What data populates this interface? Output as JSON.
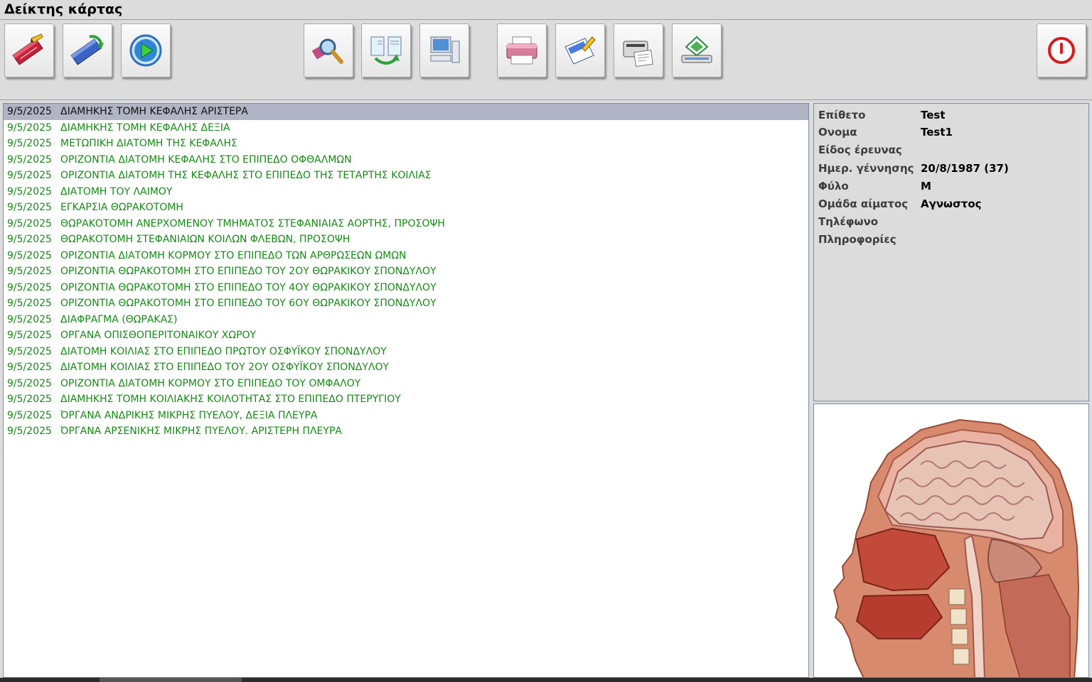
{
  "window": {
    "title": "Δείκτης κάρτας"
  },
  "toolbar": {
    "buttons": [
      {
        "icon": "edit-card-icon"
      },
      {
        "icon": "refresh-card-icon"
      },
      {
        "icon": "play-icon"
      },
      {
        "icon": "search-icon"
      },
      {
        "icon": "exchange-documents-icon"
      },
      {
        "icon": "computer-icon"
      },
      {
        "icon": "printer-icon"
      },
      {
        "icon": "edit-document-icon"
      },
      {
        "icon": "fax-printer-icon"
      },
      {
        "icon": "scanner-icon"
      },
      {
        "icon": "power-icon"
      }
    ]
  },
  "records": [
    {
      "date": "9/5/2025",
      "title": "ΔΙΑΜΗΚΗΣ ΤΟΜΗ ΚΕΦΑΛΗΣ ΑΡΙΣΤΕΡΑ",
      "selected": true
    },
    {
      "date": "9/5/2025",
      "title": "ΔΙΑΜΗΚΗΣ ΤΟΜΗ ΚΕΦΑΛΗΣ ΔΕΞΙΑ"
    },
    {
      "date": "9/5/2025",
      "title": "ΜΕΤΩΠΙΚΗ ΔΙΑΤΟΜΗ ΤΗΣ ΚΕΦΑΛΗΣ"
    },
    {
      "date": "9/5/2025",
      "title": "ΟΡΙΖΟΝΤΙΑ ΔΙΑΤΟΜΗ ΚΕΦΑΛΗΣ ΣΤΟ ΕΠΙΠΕΔΟ ΟΦΘΑΛΜΩΝ"
    },
    {
      "date": "9/5/2025",
      "title": "ΟΡΙΖΟΝΤΙΑ ΔΙΑΤΟΜΗ ΤΗΣ ΚΕΦΑΛΗΣ ΣΤΟ ΕΠΙΠΕΔΟ ΤΗΣ ΤΕΤΑΡΤΗΣ ΚΟΙΛΙΑΣ"
    },
    {
      "date": "9/5/2025",
      "title": "ΔΙΑΤΟΜΗ ΤΟΥ ΛΑΙΜΟΥ"
    },
    {
      "date": "9/5/2025",
      "title": "ΕΓΚΑΡΣΙΑ ΘΩΡΑΚΟΤΟΜΗ"
    },
    {
      "date": "9/5/2025",
      "title": "ΘΩΡΑΚΟΤΟΜΗ ΑΝΕΡΧΟΜΕΝΟΥ ΤΜΗΜΑΤΟΣ ΣΤΕΦΑΝΙΑΙΑΣ  ΑΟΡΤΗΣ, ΠΡΟΣΟΨΗ"
    },
    {
      "date": "9/5/2025",
      "title": "ΘΩΡΑΚΟΤΟΜΗ ΣΤΕΦΑΝΙΑΙΩΝ ΚΟΙΛΩΝ ΦΛΕΒΩΝ, ΠΡΟΣΟΨΗ"
    },
    {
      "date": "9/5/2025",
      "title": "ΟΡΙΖΟΝΤΙΑ ΔΙΑΤΟΜΗ ΚΟΡΜΟΥ ΣΤΟ ΕΠΙΠΕΔΟ ΤΩΝ ΑΡΘΡΩΣΕΩΝ ΩΜΩΝ"
    },
    {
      "date": "9/5/2025",
      "title": "ΟΡΙΖΟΝΤΙΑ ΘΩΡΑΚΟΤΟΜΗ ΣΤΟ ΕΠΙΠΕΔΟ ΤΟΥ 2ΟΥ ΘΩΡΑΚΙΚΟΥ ΣΠΟΝΔΥΛΟΥ"
    },
    {
      "date": "9/5/2025",
      "title": "ΟΡΙΖΟΝΤΙΑ ΘΩΡΑΚΟΤΟΜΗ ΣΤΟ ΕΠΙΠΕΔΟ ΤΟΥ 4ΟΥ ΘΩΡΑΚΙΚΟΥ ΣΠΟΝΔΥΛΟΥ"
    },
    {
      "date": "9/5/2025",
      "title": "ΟΡΙΖΟΝΤΙΑ ΘΩΡΑΚΟΤΟΜΗ ΣΤΟ ΕΠΙΠΕΔΟ ΤΟΥ 6ΟΥ ΘΩΡΑΚΙΚΟΥ ΣΠΟΝΔΥΛΟΥ"
    },
    {
      "date": "9/5/2025",
      "title": "ΔΙΑΦΡΑΓΜΑ (ΘΩΡΑΚΑΣ)"
    },
    {
      "date": "9/5/2025",
      "title": "ΟΡΓΑΝΑ ΟΠΙΣΘΟΠΕΡΙΤΟΝΑΙΚΟΥ ΧΩΡΟΥ"
    },
    {
      "date": "9/5/2025",
      "title": "ΔΙΑΤΟΜΗ ΚΟΙΛΙΑΣ ΣΤΟ ΕΠΙΠΕΔΟ ΠΡΩΤΟΥ ΟΣΦΥΪΚΟΥ ΣΠΟΝΔΥΛΟΥ"
    },
    {
      "date": "9/5/2025",
      "title": "ΔΙΑΤΟΜΗ  ΚΟΙΛΙΑΣ ΣΤΟ ΕΠΙΠΕΔΟ ΤΟΥ 2ΟΥ ΟΣΦΥΪΚΟΥ ΣΠΟΝΔΥΛΟΥ"
    },
    {
      "date": "9/5/2025",
      "title": "ΟΡΙΖΟΝΤΙΑ ΔΙΑΤΟΜΗ ΚΟΡΜΟΥ ΣΤΟ ΕΠΙΠΕΔΟ ΤΟΥ ΟΜΦΑΛΟΥ"
    },
    {
      "date": "9/5/2025",
      "title": "ΔΙΑΜΗΚΗΣ ΤΟΜΗ ΚΟΙΛΙΑΚΗΣ ΚΟΙΛΟΤΗΤΑΣ ΣΤΟ ΕΠΙΠΕΔΟ ΠΤΕΡΥΓΙΟΥ"
    },
    {
      "date": "9/5/2025",
      "title": "ΌΡΓΑΝΑ ΑΝΔΡΙΚΗΣ ΜΙΚΡΗΣ ΠΥΕΛΟΥ, ΔΕΞΙΑ ΠΛΕΥΡΑ"
    },
    {
      "date": "9/5/2025",
      "title": "ΌΡΓΑΝΑ ΑΡΣΕΝΙΚΗΣ ΜΙΚΡΗΣ ΠΥΕΛΟΥ. ΑΡΙΣΤΕΡΗ ΠΛΕΥΡΑ"
    }
  ],
  "patient": {
    "fields": [
      {
        "label": "Επίθετο",
        "value": "Test"
      },
      {
        "label": "Ονομα",
        "value": "Test1"
      },
      {
        "label": "Είδος έρευνας",
        "value": ""
      },
      {
        "label": "Ημερ. γέννησης",
        "value": "20/8/1987 (37)"
      },
      {
        "label": "Φύλο",
        "value": "M"
      },
      {
        "label": "Ομάδα αίματος",
        "value": "Αγνωστος"
      },
      {
        "label": "Τηλέφωνο",
        "value": ""
      },
      {
        "label": "Πληροφορίες",
        "value": ""
      }
    ]
  },
  "preview": {
    "image": "head-sagittal-section-image"
  },
  "colors": {
    "record_text": "#138a13",
    "selected_row": "#b1b4c4",
    "panel_border": "#7b8ea4",
    "background": "#dcdcdc"
  }
}
